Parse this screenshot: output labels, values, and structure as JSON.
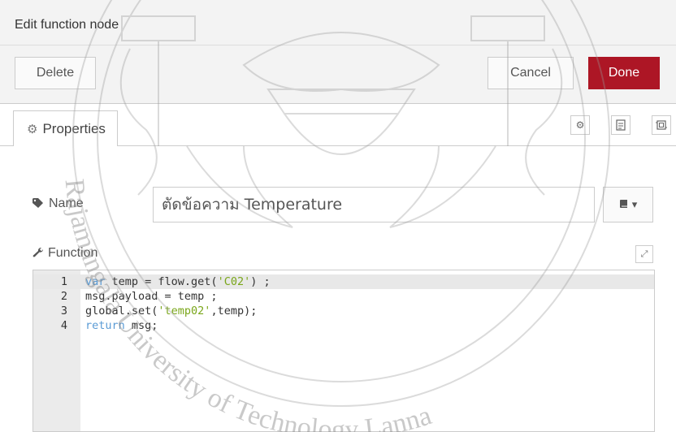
{
  "titlebar": {
    "title": "Edit function node"
  },
  "buttons": {
    "delete": "Delete",
    "cancel": "Cancel",
    "done": "Done"
  },
  "tabs": {
    "properties": "Properties"
  },
  "form": {
    "name_label": "Name",
    "name_value": "ตัดข้อความ Temperature",
    "function_label": "Function"
  },
  "editor": {
    "lines": [
      {
        "num": "1",
        "parts": [
          {
            "t": "var",
            "c": "kw2"
          },
          {
            "t": " temp = flow.get(",
            "c": "op"
          },
          {
            "t": "'C02'",
            "c": "str"
          },
          {
            "t": ") ;",
            "c": "op"
          }
        ]
      },
      {
        "num": "2",
        "parts": [
          {
            "t": "msg.payload = temp ;",
            "c": "op"
          }
        ]
      },
      {
        "num": "3",
        "parts": [
          {
            "t": "global.set(",
            "c": "op"
          },
          {
            "t": "'temp02'",
            "c": "str"
          },
          {
            "t": ",temp);",
            "c": "op"
          }
        ]
      },
      {
        "num": "4",
        "parts": [
          {
            "t": "return",
            "c": "kw2"
          },
          {
            "t": " msg;",
            "c": "op"
          }
        ]
      }
    ]
  },
  "colors": {
    "done_bg": "#ad1625",
    "panel_bg": "#f3f3f3",
    "string": "#7aa61a",
    "keyword": "#5a9bd5"
  },
  "icons": [
    "gear-icon",
    "description-icon",
    "appearance-icon",
    "tag-icon",
    "wrench-icon",
    "book-icon",
    "chevron-down-icon",
    "expand-icon"
  ],
  "watermark": {
    "arc_text": "Rajamangala University of Technology Lanna"
  }
}
